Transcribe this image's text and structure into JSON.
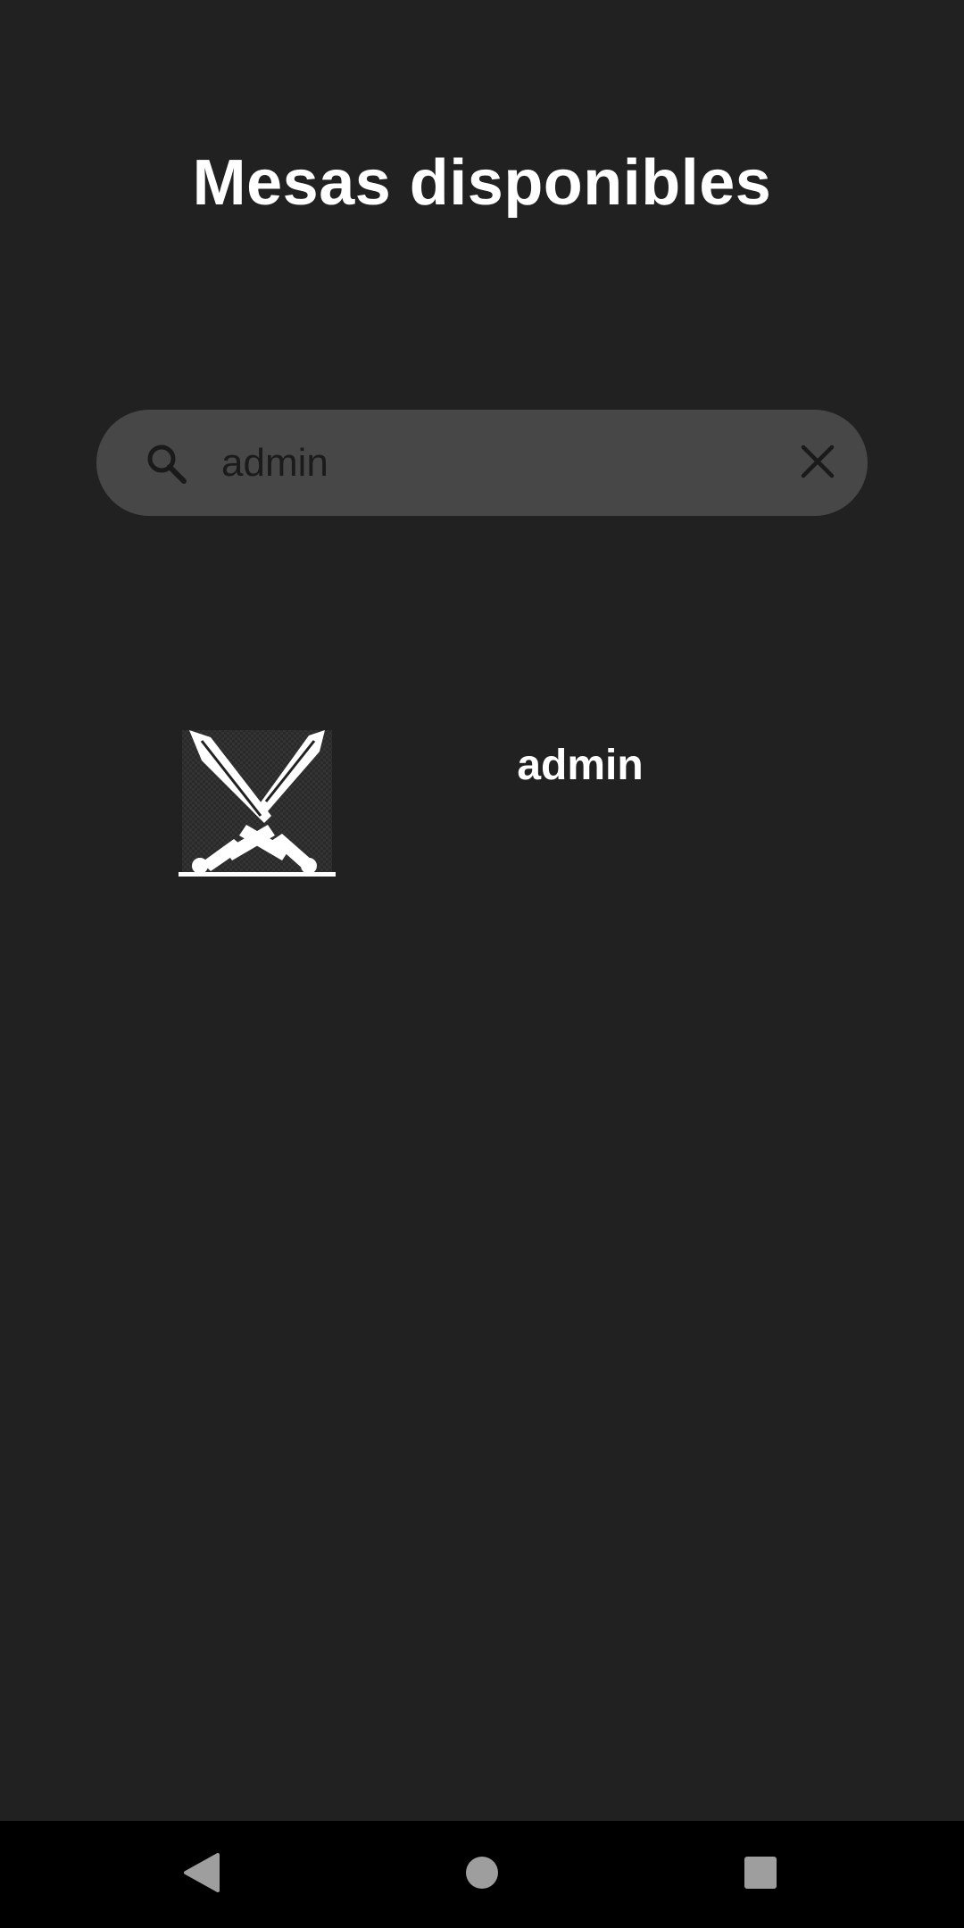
{
  "header": {
    "title": "Mesas disponibles"
  },
  "search": {
    "value": "admin",
    "search_icon": "search-icon",
    "clear_icon": "close-icon"
  },
  "results": [
    {
      "name": "admin",
      "icon": "crossed-swords-icon"
    }
  ],
  "nav": {
    "back_icon": "back-triangle-icon",
    "home_icon": "home-circle-icon",
    "recents_icon": "recents-square-icon"
  },
  "colors": {
    "background": "#212121",
    "search_bar": "#474747",
    "text": "#ffffff",
    "nav_bar": "#000000",
    "nav_icons": "#9e9e9e"
  }
}
